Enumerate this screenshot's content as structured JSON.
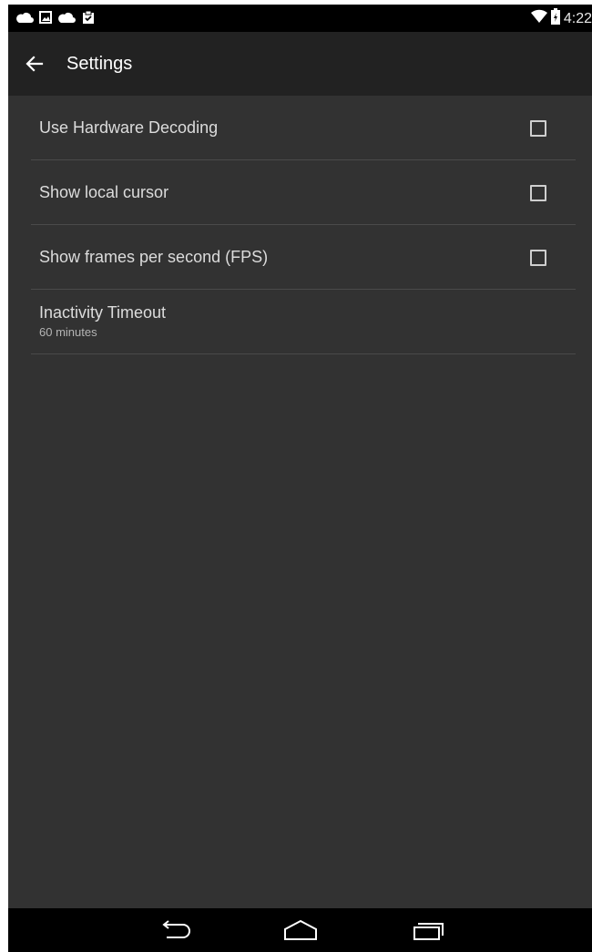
{
  "status_bar": {
    "notification_icons": [
      "cloud-icon",
      "image-icon",
      "cloud-icon",
      "clipboard-check-icon"
    ],
    "time": "4:22",
    "system_icons": [
      "wifi-icon",
      "battery-icon"
    ]
  },
  "app_bar": {
    "title": "Settings",
    "back_icon": "arrow-left-icon"
  },
  "settings": {
    "items": [
      {
        "label": "Use Hardware Decoding",
        "checked": false
      },
      {
        "label": "Show local cursor",
        "checked": false
      },
      {
        "label": "Show frames per second (FPS)",
        "checked": false
      }
    ],
    "inactivity": {
      "title": "Inactivity Timeout",
      "summary": "60 minutes"
    }
  },
  "nav_bar": {
    "buttons": [
      "back-icon",
      "home-icon",
      "recents-icon"
    ]
  },
  "colors": {
    "background": "#323232",
    "app_bar": "#222222",
    "status_bar": "#000000",
    "divider": "#4a4a4a",
    "text_primary": "#dcdcdc",
    "text_secondary": "#b4b4b4"
  }
}
